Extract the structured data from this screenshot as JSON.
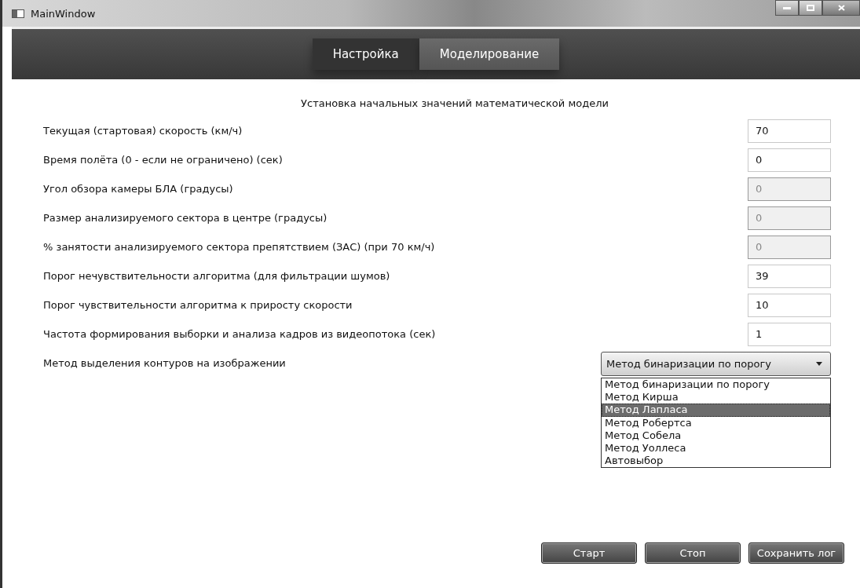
{
  "window": {
    "title": "MainWindow"
  },
  "tabs": [
    {
      "label": "Настройка",
      "selected": true
    },
    {
      "label": "Моделирование",
      "selected": false
    }
  ],
  "heading": "Установка начальных значений математической модели",
  "fields": [
    {
      "label": "Текущая (стартовая) скорость (км/ч)",
      "value": "70",
      "disabled": false
    },
    {
      "label": "Время полёта (0 - если не ограничено) (сек)",
      "value": "0",
      "disabled": false
    },
    {
      "label": "Угол обзора камеры БЛА (градусы)",
      "value": "0",
      "disabled": true
    },
    {
      "label": "Размер анализируемого сектора в центре (градусы)",
      "value": "0",
      "disabled": true
    },
    {
      "label": "% занятости анализируемого сектора препятствием (ЗАС) (при 70 км/ч)",
      "value": "0",
      "disabled": true
    },
    {
      "label": "Порог нечувствительности алгоритма (для фильтрации шумов)",
      "value": "39",
      "disabled": false
    },
    {
      "label": "Порог чувствительности алгоритма к приросту скорости",
      "value": "10",
      "disabled": false
    },
    {
      "label": "Частота формирования выборки и анализа кадров из видеопотока (сек)",
      "value": "1",
      "disabled": false
    }
  ],
  "method": {
    "label": "Метод выделения контуров на изображении",
    "value": "Метод бинаризации по порогу",
    "expanded": true,
    "options": [
      {
        "label": "Метод бинаризации по порогу",
        "highlighted": false
      },
      {
        "label": "Метод Кирша",
        "highlighted": false
      },
      {
        "label": "Метод Лапласа",
        "highlighted": true
      },
      {
        "label": "Метод Робертса",
        "highlighted": false
      },
      {
        "label": "Метод Собела",
        "highlighted": false
      },
      {
        "label": "Метод Уоллеса",
        "highlighted": false
      },
      {
        "label": "Автовыбор",
        "highlighted": false
      }
    ]
  },
  "buttons": [
    "Старт",
    "Стоп",
    "Сохранить лог"
  ]
}
